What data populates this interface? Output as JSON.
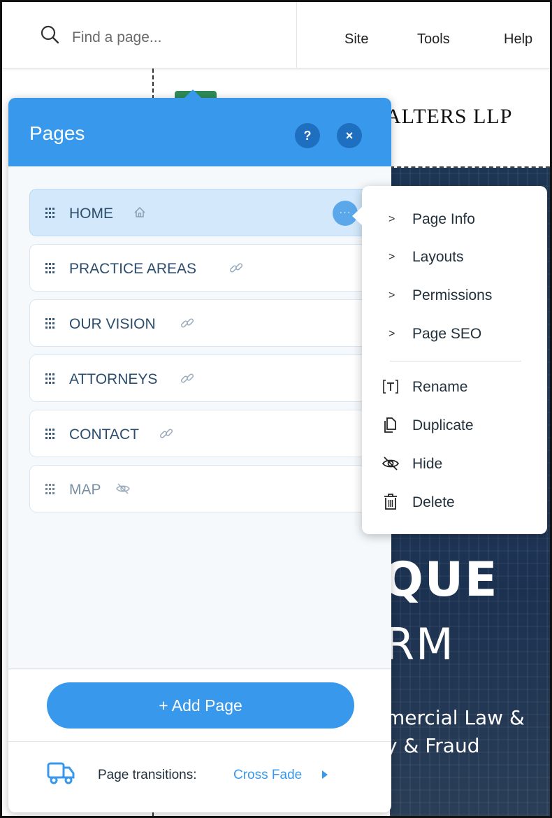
{
  "topbar": {
    "search_placeholder": "Find a page...",
    "menu": [
      "Site",
      "Tools",
      "Help"
    ]
  },
  "site_preview": {
    "header_title": "ALTERS LLP",
    "hero_line1": "QUE",
    "hero_line2": "RM",
    "hero_sub1": "mercial Law &",
    "hero_sub2": "y & Fraud"
  },
  "panel": {
    "title": "Pages",
    "help_label": "?",
    "close_label": "×",
    "pages": [
      {
        "label": "HOME",
        "icon": "home-icon",
        "selected": true
      },
      {
        "label": "PRACTICE AREAS",
        "icon": "link-icon",
        "selected": false
      },
      {
        "label": "OUR VISION",
        "icon": "link-icon",
        "selected": false
      },
      {
        "label": "ATTORNEYS",
        "icon": "link-icon",
        "selected": false
      },
      {
        "label": "CONTACT",
        "icon": "link-icon",
        "selected": false
      },
      {
        "label": "MAP",
        "icon": "hidden-icon",
        "selected": false
      }
    ],
    "more_label": "···",
    "add_page_label": "+ Add Page",
    "transitions_label": "Page transitions:",
    "transitions_value": "Cross Fade"
  },
  "context_menu": {
    "items": [
      {
        "label": "Page Info",
        "icon": "chevron-right-icon"
      },
      {
        "label": "Layouts",
        "icon": "chevron-right-icon"
      },
      {
        "label": "Permissions",
        "icon": "chevron-right-icon"
      },
      {
        "label": "Page SEO",
        "icon": "chevron-right-icon"
      },
      {
        "label": "Rename",
        "icon": "rename-icon"
      },
      {
        "label": "Duplicate",
        "icon": "duplicate-icon"
      },
      {
        "label": "Hide",
        "icon": "hide-icon"
      },
      {
        "label": "Delete",
        "icon": "trash-icon"
      }
    ],
    "chevron": ">"
  },
  "colors": {
    "accent": "#3899ec",
    "selected_row": "#d3e9fb",
    "hero_bg": "#1d3654"
  }
}
